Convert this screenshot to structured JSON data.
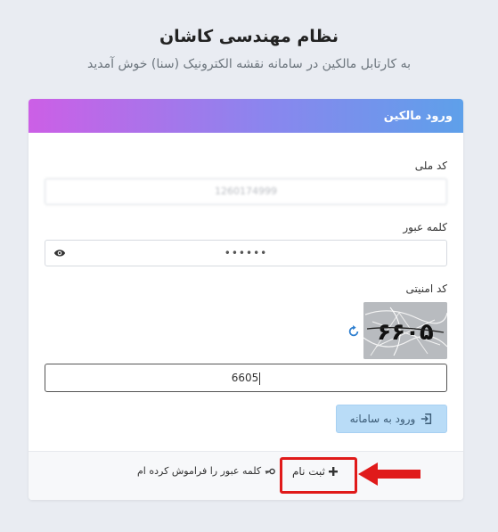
{
  "header": {
    "title": "نظام مهندسی کاشان",
    "subtitle": "به کارتابل مالکین در سامانه نقشه الکترونیک (سنا) خوش آمدید"
  },
  "card": {
    "title": "ورود مالکین",
    "national_code": {
      "label": "کد ملی",
      "value": "1260174999"
    },
    "password": {
      "label": "کلمه عبور",
      "value": "••••••",
      "icon": "eye-icon"
    },
    "captcha": {
      "label": "کد امنیتی",
      "image_text": "۶۶۰۵",
      "refresh_icon": "refresh-icon",
      "input_value": "6605"
    },
    "login_button": {
      "label": "ورود به سامانه",
      "icon": "sign-in-icon"
    }
  },
  "footer": {
    "register_label": "ثبت نام",
    "register_icon": "plus-icon",
    "forgot_label": "کلمه عبور را فراموش کرده ام",
    "forgot_icon": "key-icon"
  },
  "colors": {
    "header_gradient": [
      "#cc5fe6",
      "#8a86ee",
      "#5ea0ea"
    ],
    "annotation_red": "#e01a1a",
    "login_button_bg": "#b9dcf7"
  }
}
